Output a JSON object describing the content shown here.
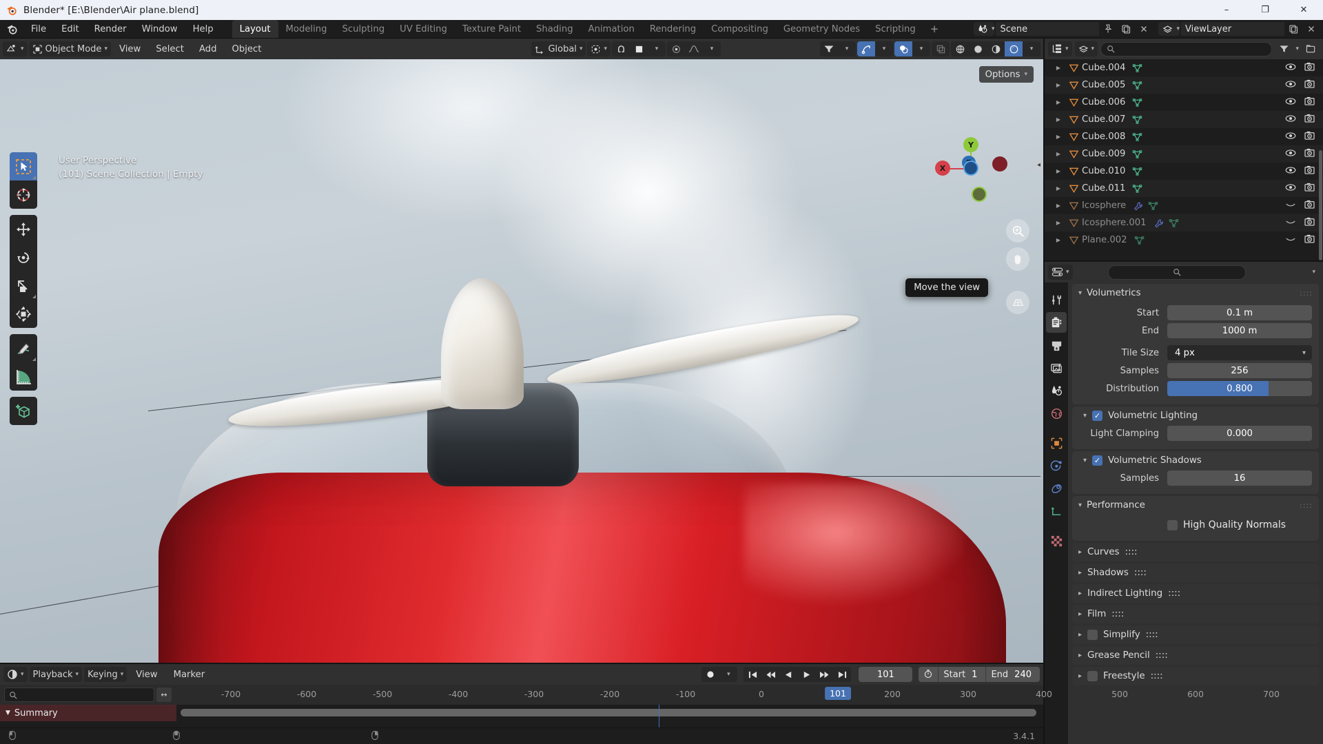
{
  "window": {
    "title": "Blender* [E:\\Blender\\Air plane.blend]",
    "minimize": "–",
    "maximize": "❐",
    "close": "✕"
  },
  "menu": {
    "items": [
      "File",
      "Edit",
      "Render",
      "Window",
      "Help"
    ],
    "workspaces": [
      {
        "label": "Layout",
        "active": true
      },
      {
        "label": "Modeling",
        "active": false
      },
      {
        "label": "Sculpting",
        "active": false
      },
      {
        "label": "UV Editing",
        "active": false
      },
      {
        "label": "Texture Paint",
        "active": false
      },
      {
        "label": "Shading",
        "active": false
      },
      {
        "label": "Animation",
        "active": false
      },
      {
        "label": "Rendering",
        "active": false
      },
      {
        "label": "Compositing",
        "active": false
      },
      {
        "label": "Geometry Nodes",
        "active": false
      },
      {
        "label": "Scripting",
        "active": false
      }
    ],
    "add_workspace": "+",
    "scene_name": "Scene",
    "view_layer_name": "ViewLayer"
  },
  "viewport_header": {
    "editor_type": "editor-type-icon",
    "mode": "Object Mode",
    "menus": [
      "View",
      "Select",
      "Add",
      "Object"
    ],
    "transform_orientation": "Global",
    "shading_modes": [
      "wireframe",
      "solid",
      "material-preview",
      "rendered"
    ],
    "active_shading": "rendered"
  },
  "viewport": {
    "overlay_line1": "User Perspective",
    "overlay_line2": "(101) Scene Collection | Empty",
    "options_label": "Options",
    "tooltip": "Move the view",
    "gizmo_axes": [
      {
        "label": "X",
        "color": "#d6404a"
      },
      {
        "label": "Y",
        "color": "#8ec93a"
      },
      {
        "label": "Z",
        "color": "#2a6fb5"
      }
    ],
    "nav_tools": [
      "zoom-icon",
      "hand-icon",
      "camera-perspective-icon"
    ]
  },
  "toolbar": {
    "tools": [
      {
        "name": "tweak-select-box",
        "active": true
      },
      {
        "name": "cursor",
        "active": false
      },
      {
        "name": "move",
        "active": false
      },
      {
        "name": "rotate",
        "active": false
      },
      {
        "name": "scale",
        "active": false
      },
      {
        "name": "transform",
        "active": false
      },
      {
        "name": "annotate",
        "active": false
      },
      {
        "name": "measure",
        "active": false
      },
      {
        "name": "add-cube",
        "active": false
      }
    ]
  },
  "timeline": {
    "editor_icon": "timeline-icon",
    "menus": [
      "Playback",
      "Keying",
      "View",
      "Marker"
    ],
    "record_icon": "record-icon",
    "transport": [
      "jump-to-start",
      "prev-keyframe",
      "play-reverse",
      "play",
      "next-keyframe",
      "jump-to-end"
    ],
    "current_frame": "101",
    "start_label": "Start",
    "start_value": "1",
    "end_label": "End",
    "end_value": "240",
    "search_placeholder": "",
    "summary_label": "Summary",
    "ruler_ticks": [
      "-700",
      "-600",
      "-500",
      "-400",
      "-300",
      "-200",
      "-100",
      "0",
      "200",
      "300",
      "400",
      "500",
      "600",
      "700"
    ],
    "playhead_label": "101"
  },
  "outliner": {
    "display_mode": "View Layer",
    "search_placeholder": "",
    "items": [
      {
        "name": "Cube.004",
        "icons": [
          "mesh-data-icon"
        ],
        "dim": false,
        "visible": true
      },
      {
        "name": "Cube.005",
        "icons": [
          "mesh-data-icon"
        ],
        "dim": false,
        "visible": true
      },
      {
        "name": "Cube.006",
        "icons": [
          "mesh-data-icon"
        ],
        "dim": false,
        "visible": true
      },
      {
        "name": "Cube.007",
        "icons": [
          "mesh-data-icon"
        ],
        "dim": false,
        "visible": true
      },
      {
        "name": "Cube.008",
        "icons": [
          "mesh-data-icon"
        ],
        "dim": false,
        "visible": true
      },
      {
        "name": "Cube.009",
        "icons": [
          "mesh-data-icon"
        ],
        "dim": false,
        "visible": true
      },
      {
        "name": "Cube.010",
        "icons": [
          "mesh-data-icon"
        ],
        "dim": false,
        "visible": true
      },
      {
        "name": "Cube.011",
        "icons": [
          "mesh-data-icon"
        ],
        "dim": false,
        "visible": true
      },
      {
        "name": "Icosphere",
        "icons": [
          "modifier-icon",
          "mesh-data-icon"
        ],
        "dim": true,
        "visible": false
      },
      {
        "name": "Icosphere.001",
        "icons": [
          "modifier-icon",
          "mesh-data-icon"
        ],
        "dim": true,
        "visible": false
      },
      {
        "name": "Plane.002",
        "icons": [
          "mesh-data-icon"
        ],
        "dim": true,
        "visible": false
      }
    ]
  },
  "properties": {
    "tabs": [
      {
        "name": "tool-icon",
        "active": false
      },
      {
        "name": "render-icon",
        "active": true
      },
      {
        "name": "output-icon",
        "active": false
      },
      {
        "name": "view-layer-icon",
        "active": false
      },
      {
        "name": "scene-icon",
        "active": false
      },
      {
        "name": "world-icon",
        "active": false
      },
      {
        "name": "object-icon",
        "active": false
      },
      {
        "name": "modifier-physics-icon",
        "active": false
      },
      {
        "name": "constraints-icon",
        "active": false
      },
      {
        "name": "object-data-icon",
        "active": false
      },
      {
        "name": "material-icon",
        "active": false
      }
    ],
    "volumetrics": {
      "title": "Volumetrics",
      "fields": [
        {
          "label": "Start",
          "value": "0.1 m",
          "type": "number"
        },
        {
          "label": "End",
          "value": "1000 m",
          "type": "number"
        },
        {
          "label": "Tile Size",
          "value": "4 px",
          "type": "dropdown"
        },
        {
          "label": "Samples",
          "value": "256",
          "type": "number"
        },
        {
          "label": "Distribution",
          "value": "0.800",
          "type": "slider",
          "fill": 70
        }
      ],
      "volumetric_lighting": {
        "label": "Volumetric Lighting",
        "checked": true
      },
      "light_clamping": {
        "label": "Light Clamping",
        "value": "0.000"
      },
      "volumetric_shadows": {
        "label": "Volumetric Shadows",
        "checked": true
      },
      "shadow_samples": {
        "label": "Samples",
        "value": "16"
      }
    },
    "performance": {
      "title": "Performance",
      "high_quality_normals": {
        "label": "High Quality Normals",
        "checked": false
      }
    },
    "collapsed_panels": [
      {
        "label": "Curves",
        "checkbox": false
      },
      {
        "label": "Shadows",
        "checkbox": false
      },
      {
        "label": "Indirect Lighting",
        "checkbox": false
      },
      {
        "label": "Film",
        "checkbox": false
      },
      {
        "label": "Simplify",
        "checkbox": true,
        "checked": false
      },
      {
        "label": "Grease Pencil",
        "checkbox": false
      },
      {
        "label": "Freestyle",
        "checkbox": true,
        "checked": false
      }
    ]
  },
  "status": {
    "version": "3.4.1"
  },
  "colors": {
    "accent": "#4772b3",
    "mesh_icon": "#4db38a",
    "object_icon": "#e08a3c",
    "summary": "#4a2528"
  }
}
